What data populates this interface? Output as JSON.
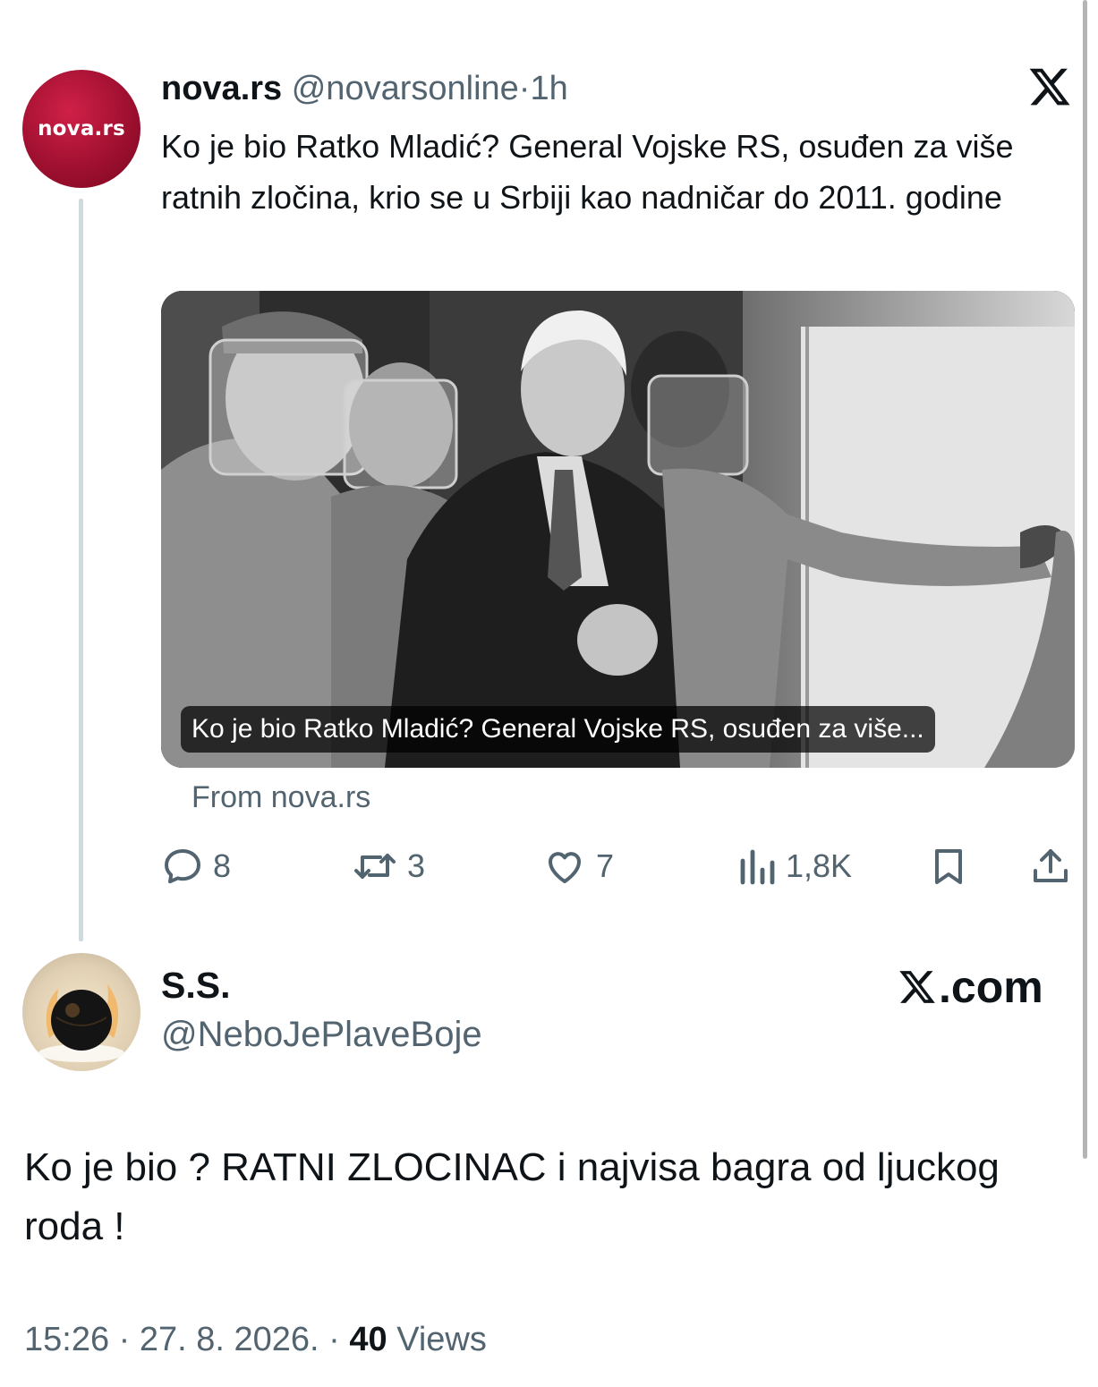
{
  "original_tweet": {
    "avatar_text": "nova.rs",
    "display_name": "nova.rs",
    "handle": "@novarsonline",
    "separator": "·",
    "time": "1h",
    "text": "Ko je bio Ratko Mladić? General Vojske RS, osuđen za više ratnih zločina, krio se u Srbiji kao nadničar do 2011. godine",
    "link_card": {
      "caption": "Ko je bio Ratko Mladić? General Vojske RS, osuđen za više...",
      "source": "From nova.rs"
    },
    "actions": {
      "replies": "8",
      "reposts": "3",
      "likes": "7",
      "views": "1,8K"
    }
  },
  "quote_card": {
    "brand": ".com",
    "display_name": "S.S.",
    "handle": "@NeboJePlaveBoje",
    "text": "Ko je bio ? RATNI ZLOCINAC i najvisa  bagra  od ljuckog roda !",
    "timestamp": "15:26 · 27. 8. 2026. · ",
    "views_count": "40",
    "views_label": " Views"
  },
  "icons": [
    "x-logo-icon",
    "reply-icon",
    "repost-icon",
    "like-icon",
    "views-icon",
    "bookmark-icon",
    "share-icon"
  ],
  "colors": {
    "text": "#0f1419",
    "secondary": "#536471",
    "avatar_red": "#a01030"
  }
}
